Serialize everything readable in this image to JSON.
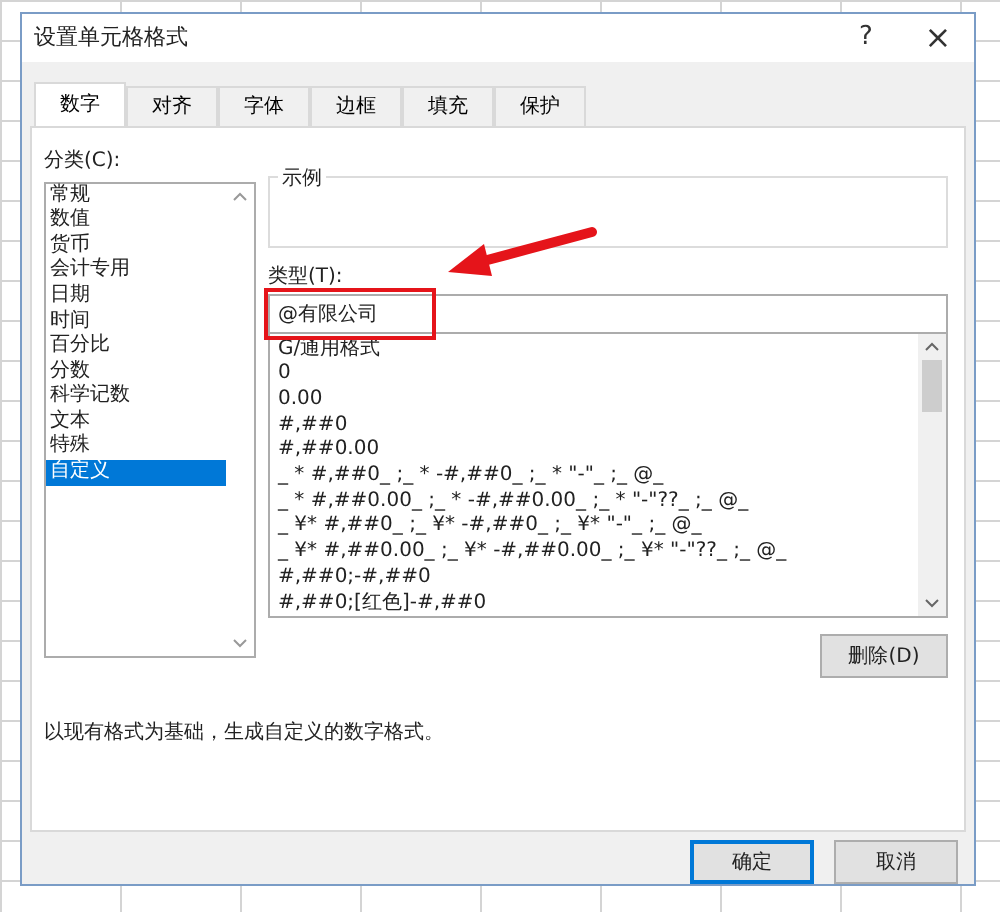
{
  "window": {
    "title": "设置单元格格式",
    "help": "?",
    "close": "×"
  },
  "tabs": [
    {
      "label": "数字",
      "selected": true
    },
    {
      "label": "对齐",
      "selected": false
    },
    {
      "label": "字体",
      "selected": false
    },
    {
      "label": "边框",
      "selected": false
    },
    {
      "label": "填充",
      "selected": false
    },
    {
      "label": "保护",
      "selected": false
    }
  ],
  "category": {
    "label": "分类(C):",
    "items": [
      {
        "label": "常规",
        "selected": false
      },
      {
        "label": "数值",
        "selected": false
      },
      {
        "label": "货币",
        "selected": false
      },
      {
        "label": "会计专用",
        "selected": false
      },
      {
        "label": "日期",
        "selected": false
      },
      {
        "label": "时间",
        "selected": false
      },
      {
        "label": "百分比",
        "selected": false
      },
      {
        "label": "分数",
        "selected": false
      },
      {
        "label": "科学记数",
        "selected": false
      },
      {
        "label": "文本",
        "selected": false
      },
      {
        "label": "特殊",
        "selected": false
      },
      {
        "label": "自定义",
        "selected": true
      }
    ]
  },
  "sample": {
    "label": "示例"
  },
  "type": {
    "label": "类型(T):",
    "value": "@有限公司",
    "items": [
      "G/通用格式",
      "0",
      "0.00",
      "#,##0",
      "#,##0.00",
      "_ * #,##0_ ;_ * -#,##0_ ;_ * \"-\"_ ;_ @_",
      "_ * #,##0.00_ ;_ * -#,##0.00_ ;_ * \"-\"??_ ;_ @_",
      "_ ¥* #,##0_ ;_ ¥* -#,##0_ ;_ ¥* \"-\"_ ;_ @_",
      "_ ¥* #,##0.00_ ;_ ¥* -#,##0.00_ ;_ ¥* \"-\"??_ ;_ @_",
      "#,##0;-#,##0",
      "#,##0;[红色]-#,##0"
    ]
  },
  "delete_button": "删除(D)",
  "description": "以现有格式为基础，生成自定义的数字格式。",
  "buttons": [
    {
      "label": "确定",
      "kind": "default"
    },
    {
      "label": "取消",
      "kind": "normal"
    }
  ]
}
